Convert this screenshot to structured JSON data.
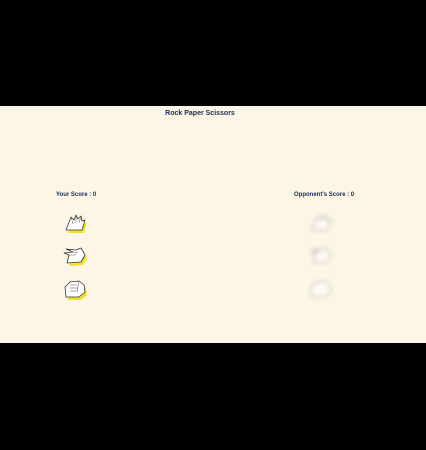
{
  "title": "Rock Paper Scissors",
  "player": {
    "score_label": "Your Score : 0",
    "choices": [
      "paper",
      "scissors",
      "rock"
    ]
  },
  "opponent": {
    "score_label": "Opponent's Score : 0",
    "choices": [
      "paper",
      "scissors",
      "rock"
    ]
  },
  "colors": {
    "background": "#fdf6e6",
    "text": "#1a2a55",
    "hand_shadow": "#f2e12a"
  }
}
